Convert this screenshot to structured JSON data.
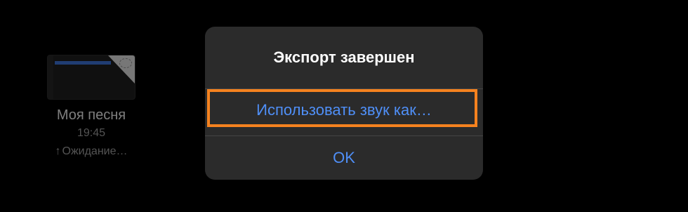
{
  "song": {
    "name": "Моя песня",
    "time": "19:45",
    "status_arrow": "↑",
    "status_text": "Ожидание…"
  },
  "alert": {
    "title": "Экспорт завершен",
    "actions": [
      {
        "label": "Использовать звук как…",
        "highlighted": true
      },
      {
        "label": "OK",
        "highlighted": false
      }
    ]
  },
  "colors": {
    "background": "#000000",
    "alert_background": "#2b2b2b",
    "action_text": "#4f8ff7",
    "highlight": "#f5821f",
    "thumb_track": "#3b6fd1"
  }
}
